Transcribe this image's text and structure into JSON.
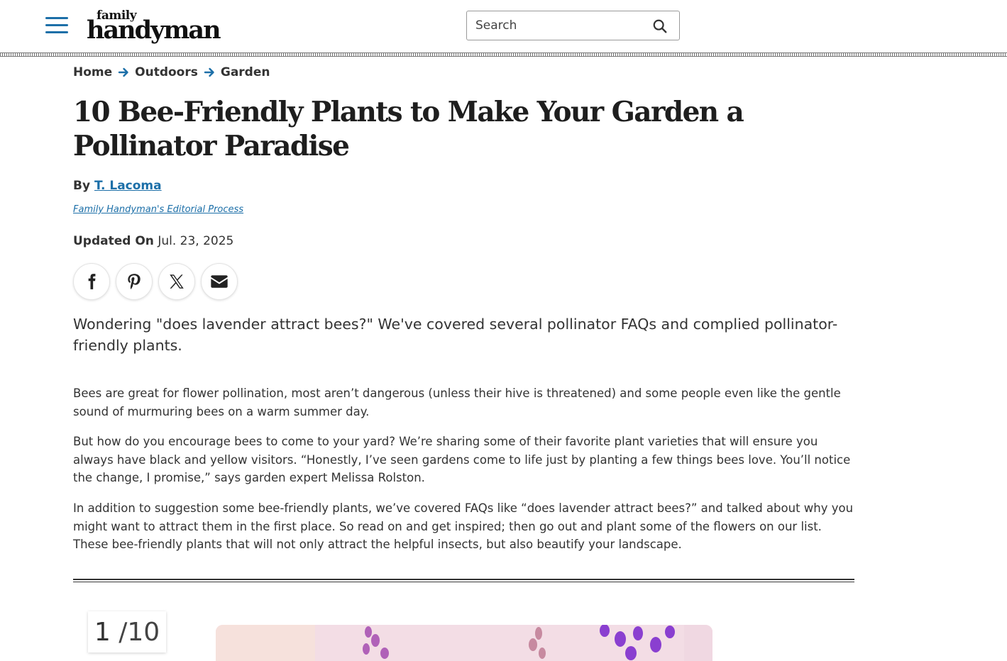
{
  "header": {
    "logo_top": "family",
    "logo_main": "handyman",
    "search_placeholder": "Search"
  },
  "breadcrumb": {
    "items": [
      "Home",
      "Outdoors",
      "Garden"
    ]
  },
  "article": {
    "title": "10 Bee-Friendly Plants to Make Your Garden a Pollinator Paradise",
    "by_label": "By",
    "author": "T. Lacoma",
    "editorial_link": "Family Handyman's Editorial Process",
    "updated_label": "Updated On",
    "updated_date": "Jul. 23, 2025",
    "dek": "Wondering \"does lavender attract bees?\" We've covered several pollinator FAQs and complied pollinator-friendly plants.",
    "paragraphs": [
      "Bees are great for flower pollination, most aren’t dangerous (unless their hive is threatened) and some people even like the gentle sound of murmuring bees on a warm summer day.",
      "But how do you encourage bees to come to your yard? We’re sharing some of their favorite plant varieties that will ensure you always have black and yellow visitors. “Honestly, I’ve seen gardens come to life just by planting a few things bees love. You’ll notice the change, I promise,” says garden expert Melissa Rolston.",
      "In addition to suggestion some bee-friendly plants, we’ve covered FAQs like “does lavender attract bees?” and talked about why you might want to attract them in the first place. So read on and get inspired; then go out and plant some of the flowers on our list. These bee-friendly plants that will not only attract the helpful insects, but also beautify your landscape."
    ]
  },
  "share": {
    "icons": [
      "facebook-icon",
      "pinterest-icon",
      "x-icon",
      "email-icon"
    ]
  },
  "slideshow": {
    "current": "1",
    "total": "/10"
  },
  "colors": {
    "accent": "#1c6fa8",
    "text": "#333333",
    "title": "#1e1e1e"
  }
}
